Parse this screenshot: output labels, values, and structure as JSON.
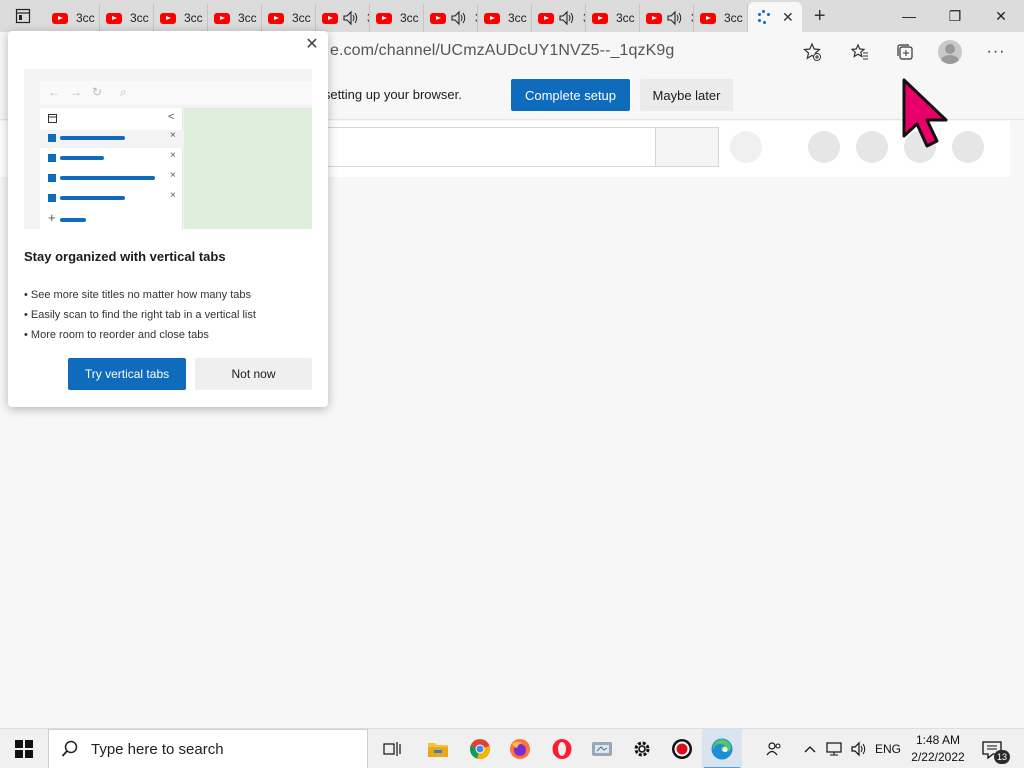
{
  "browser": {
    "tab_title_truncated": "3cc",
    "tabs": [
      {
        "favicon": "youtube-icon",
        "audio": false
      },
      {
        "favicon": "youtube-icon",
        "audio": false
      },
      {
        "favicon": "youtube-icon",
        "audio": false
      },
      {
        "favicon": "youtube-icon",
        "audio": false
      },
      {
        "favicon": "youtube-icon",
        "audio": false
      },
      {
        "favicon": "youtube-icon",
        "audio": true
      },
      {
        "favicon": "youtube-icon",
        "audio": false
      },
      {
        "favicon": "youtube-icon",
        "audio": true
      },
      {
        "favicon": "youtube-icon",
        "audio": false
      },
      {
        "favicon": "youtube-icon",
        "audio": true
      },
      {
        "favicon": "youtube-icon",
        "audio": false
      },
      {
        "favicon": "youtube-icon",
        "audio": true
      },
      {
        "favicon": "youtube-icon",
        "audio": false
      }
    ],
    "active_tab": {
      "favicon": "loading-icon",
      "close": "✕"
    },
    "new_tab": "+",
    "url_visible": "e.com/channel/UCmzAUDcUY1NVZ5--_1qzK9g"
  },
  "window_controls": {
    "minimize": "—",
    "restore": "❐",
    "close": "✕"
  },
  "infobar": {
    "text": "h setting up your browser.",
    "primary_button": "Complete setup",
    "secondary_button": "Maybe later"
  },
  "popup": {
    "title": "Stay organized with vertical tabs",
    "bullets": [
      "See more site titles no matter how many tabs",
      "Easily scan to find the right tab in a vertical list",
      "More room to reorder and close tabs"
    ],
    "primary_button": "Try vertical tabs",
    "secondary_button": "Not now",
    "close": "✕",
    "illustration": {
      "rows": [
        {
          "highlighted": true,
          "line_fraction": 0.62
        },
        {
          "highlighted": false,
          "line_fraction": 0.42
        },
        {
          "highlighted": false,
          "line_fraction": 0.9
        },
        {
          "highlighted": false,
          "line_fraction": 0.62
        }
      ],
      "add_symbol": "+",
      "collapse_symbol": "<",
      "row_close": "×"
    }
  },
  "taskbar": {
    "search_placeholder": "Type here to search",
    "apps": [
      "task-view-icon",
      "file-explorer-icon",
      "chrome-icon",
      "firefox-icon",
      "opera-icon",
      "screen-tool-icon",
      "settings-icon",
      "record-icon",
      "edge-icon"
    ],
    "language": "ENG",
    "time": "1:48 AM",
    "date": "2/22/2022",
    "notification_count": "13"
  },
  "colors": {
    "accent": "#0f6cbd",
    "youtube": "#ff0000",
    "cursor": "#e8006a"
  }
}
